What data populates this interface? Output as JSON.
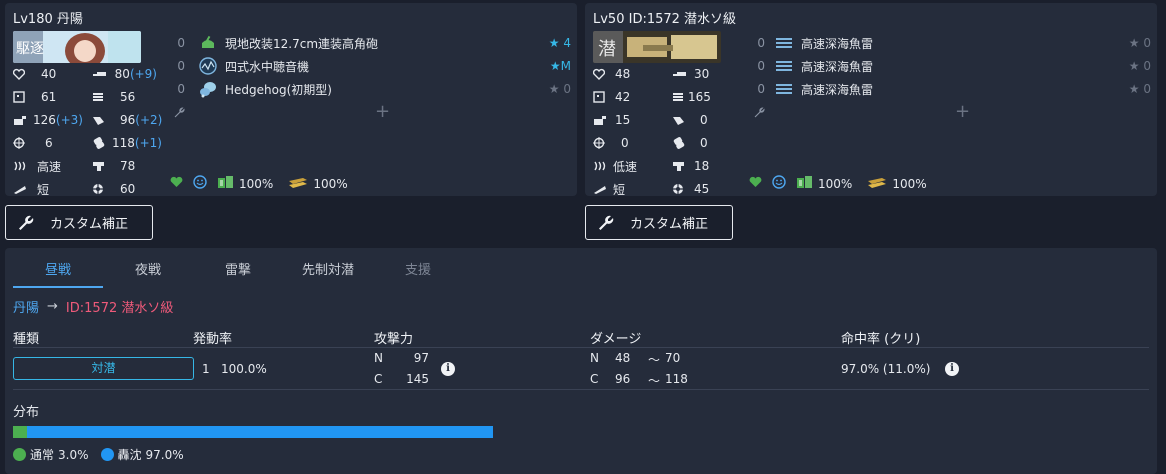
{
  "ships": [
    {
      "title": "Lv180  丹陽",
      "stats": {
        "hp": "40",
        "fire": "80",
        "fire_bonus": "(+9)",
        "armor": "61",
        "torpedo": "56",
        "aa": "126",
        "aa_bonus": "(+3)",
        "asw": "96",
        "asw_bonus": "(+2)",
        "evasion": "6",
        "los": "118",
        "los_bonus": "(+1)",
        "speed": "高速",
        "luck": "78",
        "range": "短",
        "accuracy": "60"
      },
      "slots": [
        {
          "count": "0",
          "icon": "gun-green-icon",
          "name": "現地改装12.7cm連装高角砲",
          "star": "★ 4",
          "star_on": true
        },
        {
          "count": "0",
          "icon": "sonar-icon",
          "name": "四式水中聴音機",
          "star": "★M",
          "star_on": true
        },
        {
          "count": "0",
          "icon": "depth-charge-icon",
          "name": "Hedgehog(初期型)",
          "star": "★ 0",
          "star_on": false
        }
      ],
      "fuel": "100%",
      "ammo": "100%"
    },
    {
      "title": "Lv50   ID:1572 潜水ソ級",
      "stats": {
        "hp": "48",
        "fire": "30",
        "armor": "42",
        "torpedo": "165",
        "aa": "15",
        "asw": "0",
        "evasion": "0",
        "los": "0",
        "speed": "低速",
        "luck": "18",
        "range": "短",
        "accuracy": "45"
      },
      "slots": [
        {
          "count": "0",
          "icon": "torpedo-icon",
          "name": "高速深海魚雷",
          "star": "★ 0",
          "star_on": false
        },
        {
          "count": "0",
          "icon": "torpedo-icon",
          "name": "高速深海魚雷",
          "star": "★ 0",
          "star_on": false
        },
        {
          "count": "0",
          "icon": "torpedo-icon",
          "name": "高速深海魚雷",
          "star": "★ 0",
          "star_on": false
        }
      ],
      "fuel": "100%",
      "ammo": "100%"
    }
  ],
  "custom_button_label": "カスタム補正",
  "tabs": [
    {
      "label": "昼戦",
      "state": "active"
    },
    {
      "label": "夜戦",
      "state": "normal"
    },
    {
      "label": "雷撃",
      "state": "normal"
    },
    {
      "label": "先制対潜",
      "state": "normal"
    },
    {
      "label": "支援",
      "state": "disabled"
    }
  ],
  "route": {
    "from": "丹陽",
    "arrow": "→",
    "to": "ID:1572 潜水ソ級"
  },
  "table": {
    "headers": {
      "type": "種類",
      "rate": "発動率",
      "power": "攻撃力",
      "damage": "ダメージ",
      "hit": "命中率 (クリ)"
    },
    "row": {
      "type": "対潜",
      "rate_count": "1",
      "rate": "100.0%",
      "power_n_label": "N",
      "power_n": "97",
      "power_c_label": "C",
      "power_c": "145",
      "dmg_n_label": "N",
      "dmg_n_min": "48",
      "dmg_n_sep": "～",
      "dmg_n_max": "70",
      "dmg_c_label": "C",
      "dmg_c_min": "96",
      "dmg_c_sep": "～",
      "dmg_c_max": "118",
      "hit": "97.0%  (11.0%)"
    }
  },
  "distribution": {
    "label": "分布",
    "normal_label": "通常",
    "normal_value": "3.0%",
    "normal_fraction": 0.03,
    "sunk_label": "轟沈",
    "sunk_value": "97.0%",
    "sunk_fraction": 0.97
  },
  "colors": {
    "accent": "#4ea7f0",
    "target": "#ee5a7a",
    "star": "#36b7e6",
    "normal": "#4caf50",
    "sunk": "#2196f3"
  }
}
